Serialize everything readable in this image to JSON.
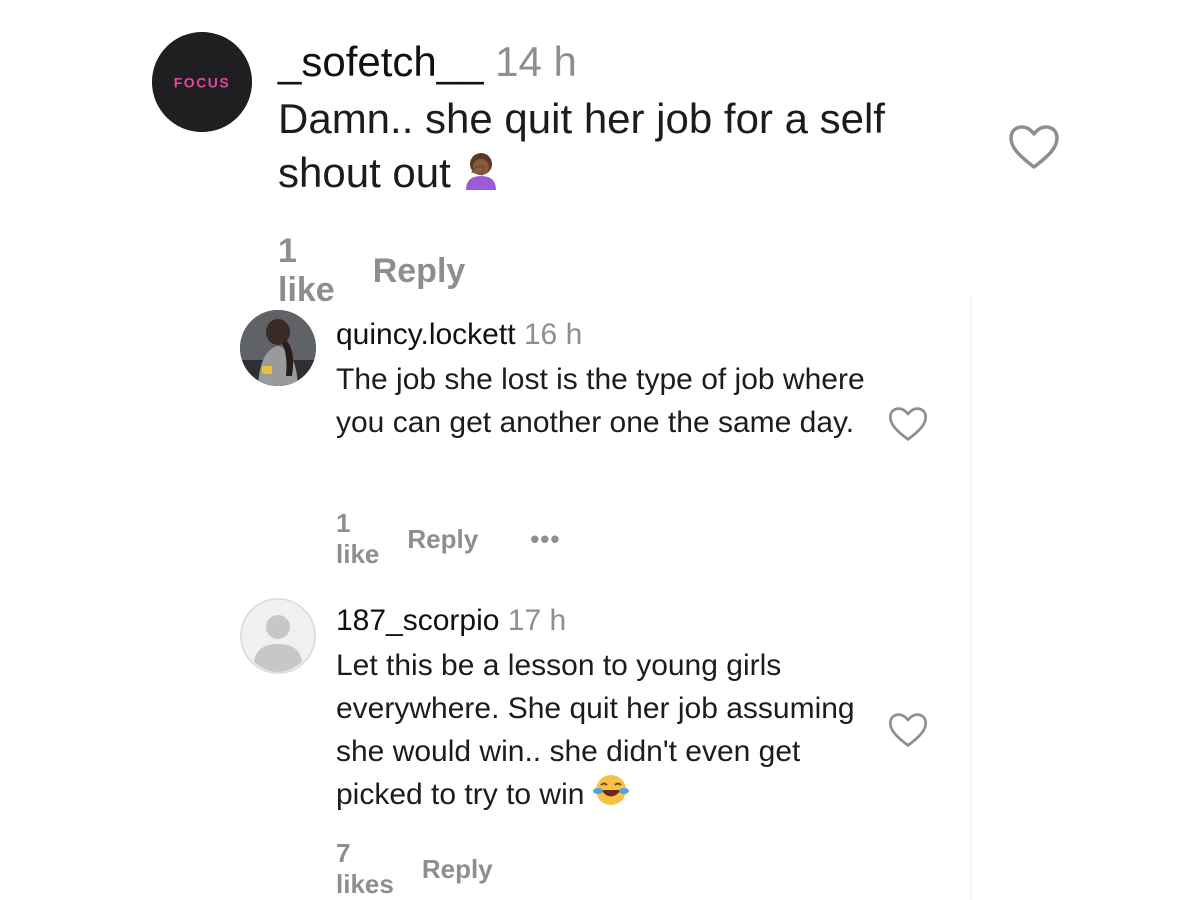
{
  "comments": [
    {
      "username": "_sofetch__",
      "time": "14 h",
      "text": "Damn.. she quit her job for a self shout out",
      "emoji": "person-facepalming-emoji",
      "likes": "1 like",
      "reply_label": "Reply",
      "avatar_text": "FOCUS"
    },
    {
      "username": "quincy.lockett",
      "time": "16 h",
      "text": "The job she lost is the type of job where you can get another one the same day.",
      "likes": "1 like",
      "reply_label": "Reply",
      "more_label": "•••"
    },
    {
      "username": "187_scorpio",
      "time": "17 h",
      "text": "Let this be a lesson to young girls everywhere. She quit her job assuming she would win.. she didn't even get picked to try to win",
      "emoji": "face-with-tears-of-joy-emoji",
      "likes": "7 likes",
      "reply_label": "Reply"
    }
  ],
  "colors": {
    "focus_neon": "#e0489c",
    "muted_text": "#8e8e8e",
    "heart_stroke": "#8e8e8e"
  }
}
